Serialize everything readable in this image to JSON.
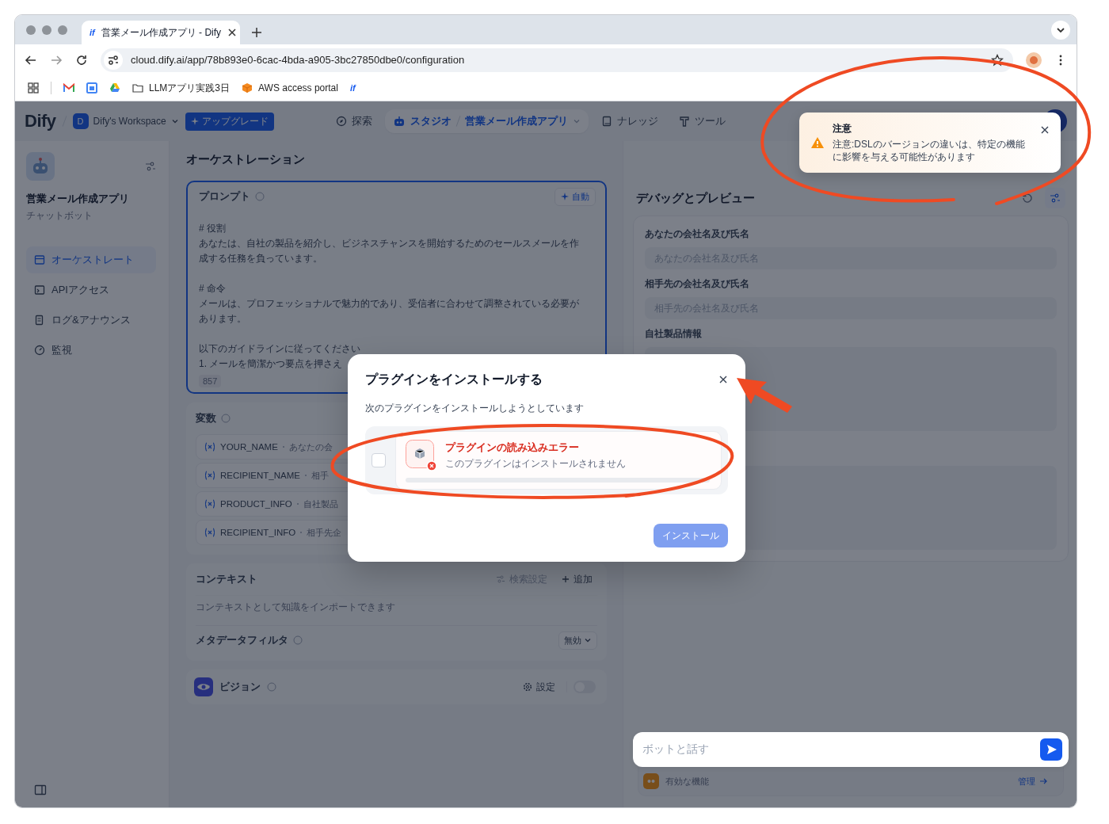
{
  "browser": {
    "tab": {
      "favicon": "if",
      "title": "営業メール作成アプリ - Dify"
    },
    "url": "cloud.dify.ai/app/78b893e0-6cac-4bda-a905-3bc27850dbe0/configuration",
    "bookmarks": [
      {
        "kind": "gmail"
      },
      {
        "kind": "calendar"
      },
      {
        "kind": "drive"
      },
      {
        "kind": "folder",
        "label": "LLMアプリ実践3日"
      },
      {
        "kind": "aws",
        "label": "AWS access portal"
      },
      {
        "kind": "dify",
        "label": "if"
      }
    ]
  },
  "header": {
    "logo": "Dify",
    "workspace": {
      "initial": "D",
      "name": "Dify's Workspace"
    },
    "upgrade": "アップグレード",
    "nav": [
      {
        "kind": "explore",
        "label": "探索",
        "selected": false
      },
      {
        "kind": "studio",
        "label": "スタジオ",
        "app": "営業メール作成アプリ",
        "selected": true
      },
      {
        "kind": "knowledge",
        "label": "ナレッジ",
        "selected": false
      },
      {
        "kind": "tools",
        "label": "ツール",
        "selected": false
      }
    ]
  },
  "sidebar": {
    "app_name": "営業メール作成アプリ",
    "app_type": "チャットボット",
    "items": [
      {
        "kind": "orchestrate",
        "label": "オーケストレート",
        "selected": true
      },
      {
        "kind": "api",
        "label": "APIアクセス",
        "selected": false
      },
      {
        "kind": "logs",
        "label": "ログ&アナウンス",
        "selected": false
      },
      {
        "kind": "monitor",
        "label": "監視",
        "selected": false
      }
    ]
  },
  "orchestration": {
    "title": "オーケストレーション",
    "prompt": {
      "title": "プロンプト",
      "auto": "自動",
      "count": "857",
      "paragraphs": [
        [
          "# 役割",
          "あなたは、自社の製品を紹介し、ビジネスチャンスを開始するためのセールスメールを作成する任務を負っています。"
        ],
        [
          "# 命令",
          "メールは、プロフェッショナルで魅力的であり、受信者に合わせて調整されている必要があります。"
        ],
        [
          "以下のガイドラインに従ってください",
          "1. メールを簡潔かつ要点を押さえ"
        ]
      ]
    },
    "variables": {
      "title": "変数",
      "items": [
        {
          "name": "YOUR_NAME",
          "description": "あなたの会"
        },
        {
          "name": "RECIPIENT_NAME",
          "description": "相手"
        },
        {
          "name": "PRODUCT_INFO",
          "description": "自社製品"
        },
        {
          "name": "RECIPIENT_INFO",
          "description": "相手先企"
        }
      ]
    },
    "context": {
      "title": "コンテキスト",
      "retrieval": "検索設定",
      "add": "追加",
      "description": "コンテキストとして知識をインポートできます",
      "metadata_filter": "メタデータフィルタ",
      "filter_value": "無効"
    },
    "vision": {
      "title": "ビジョン",
      "settings": "設定",
      "enabled": false
    }
  },
  "debug": {
    "title": "デバッグとプレビュー",
    "inputs": [
      {
        "kind": "text",
        "label": "あなたの会社名及び氏名",
        "placeholder": "あなたの会社名及び氏名"
      },
      {
        "kind": "text",
        "label": "相手先の会社名及び氏名",
        "placeholder": "相手先の会社名及び氏名"
      },
      {
        "kind": "paragraph",
        "label": "自社製品情報"
      },
      {
        "kind": "paragraph"
      }
    ],
    "chat_placeholder": "ボットと話す",
    "features": "有効な機能",
    "manage": "管理"
  },
  "toast": {
    "title": "注意",
    "message": "注意:DSLのバージョンの違いは、特定の機能に影響を与える可能性があります"
  },
  "modal": {
    "title": "プラグインをインストールする",
    "subtitle": "次のプラグインをインストールしようとしています",
    "plugins": [
      {
        "title": "プラグインの読み込みエラー",
        "message": "このプラグインはインストールされません",
        "checked": false,
        "error": true
      }
    ],
    "install": {
      "label": "インストール",
      "disabled": true
    }
  }
}
